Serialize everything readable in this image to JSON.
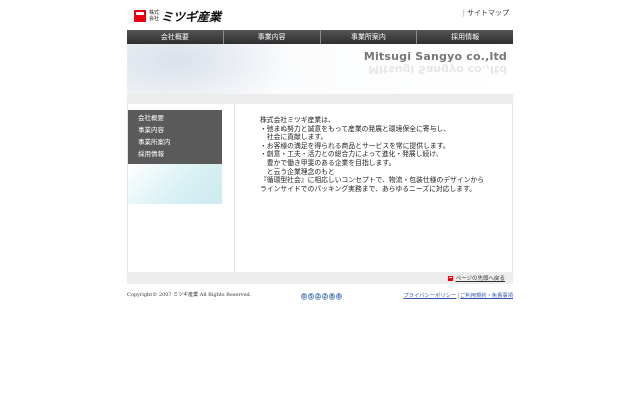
{
  "header": {
    "logo_small_line1": "株式",
    "logo_small_line2": "会社",
    "logo_text": "ミツギ産業",
    "sitemap_label": "サイトマップ"
  },
  "nav": [
    {
      "label": "会社概要"
    },
    {
      "label": "事業内容"
    },
    {
      "label": "事業所案内"
    },
    {
      "label": "採用情報"
    }
  ],
  "banner": {
    "title": "Mitsugi Sangyo co.,ltd"
  },
  "sidebar": {
    "items": [
      {
        "label": "会社概要"
      },
      {
        "label": "事業内容"
      },
      {
        "label": "事業所案内"
      },
      {
        "label": "採用情報"
      }
    ]
  },
  "main": {
    "lines": [
      "株式会社ミツギ産業は、",
      "・弛まぬ努力と誠意をもって産業の発展と環境保全に寄与し、",
      "　社会に貢献します。",
      "・お客様の満足を得られる商品とサービスを常に提供します。",
      "・創意・工夫・活力との総合力によって進化・発展し続け、",
      "　豊かで働き甲斐のある企業を目指します。",
      "　と云う企業理念のもと",
      "『循環型社会』に相応しいコンセプトで、物流・包装仕様のデザインから",
      "ラインサイドでのパッキング実務まで、あらゆるニーズに対応します。"
    ]
  },
  "footer": {
    "pagetop_label": "ページの先頭へ戻る",
    "copyright": "Copyright© 2007 ミツギ産業 All Rights Reserved.",
    "counter_digits": [
      "0",
      "5",
      "2",
      "2",
      "8",
      "6"
    ],
    "privacy_link": "プライバシーポリシー",
    "separator": "|",
    "terms_link": "ご利用規約・免責事項"
  },
  "colors": {
    "brand_red": "#e60012",
    "nav_bg": "#3b3b3b",
    "sidebar_bg": "#5a5a5a"
  }
}
